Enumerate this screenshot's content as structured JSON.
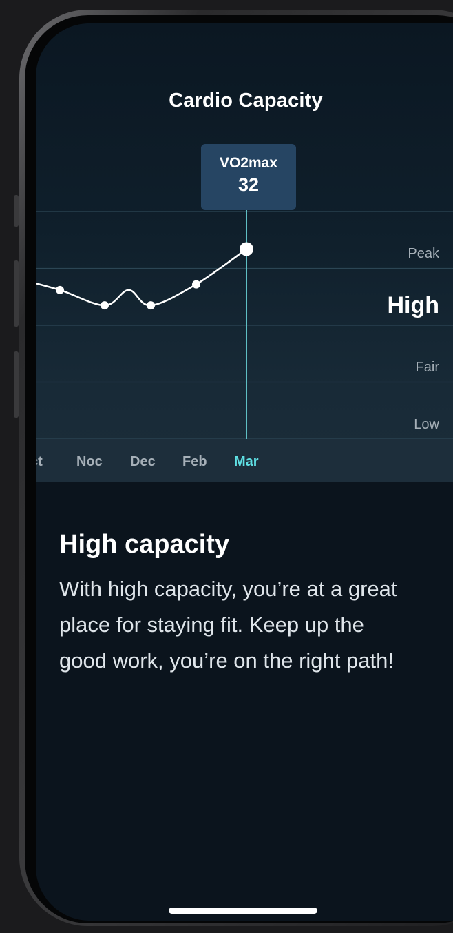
{
  "screen": {
    "title": "Cardio Capacity"
  },
  "tooltip": {
    "label": "VO2max",
    "value": "32"
  },
  "bands": [
    {
      "label": "Peak"
    },
    {
      "label": "High",
      "active": true
    },
    {
      "label": "Fair"
    },
    {
      "label": "Low"
    }
  ],
  "chart_data": {
    "type": "line",
    "categories": [
      "Oct",
      "Noc",
      "Dec",
      "Feb",
      "Mar"
    ],
    "visible_tick_labels": [
      "ct",
      "Noc",
      "Dec",
      "Feb",
      "Mar"
    ],
    "series": [
      {
        "values": [
          2.8,
          2.62,
          2.35,
          2.62,
          2.35,
          2.72,
          3.34
        ]
      }
    ],
    "point_categories": [
      "",
      "Oct",
      "Noc",
      "",
      "Dec",
      "Feb",
      "Mar"
    ],
    "selected": {
      "category": "Mar",
      "label": "VO2max",
      "value": 32
    },
    "band_scale": [
      "Low",
      "Fair",
      "High",
      "Peak"
    ],
    "colors": {
      "line": "#ffffff",
      "cursor": "#5fbfc4",
      "grid": "#2c4655"
    }
  },
  "description": {
    "heading": "High capacity",
    "text": "With high capacity, you’re at a great place for staying fit. Keep up the good work, you’re on the right path!"
  }
}
